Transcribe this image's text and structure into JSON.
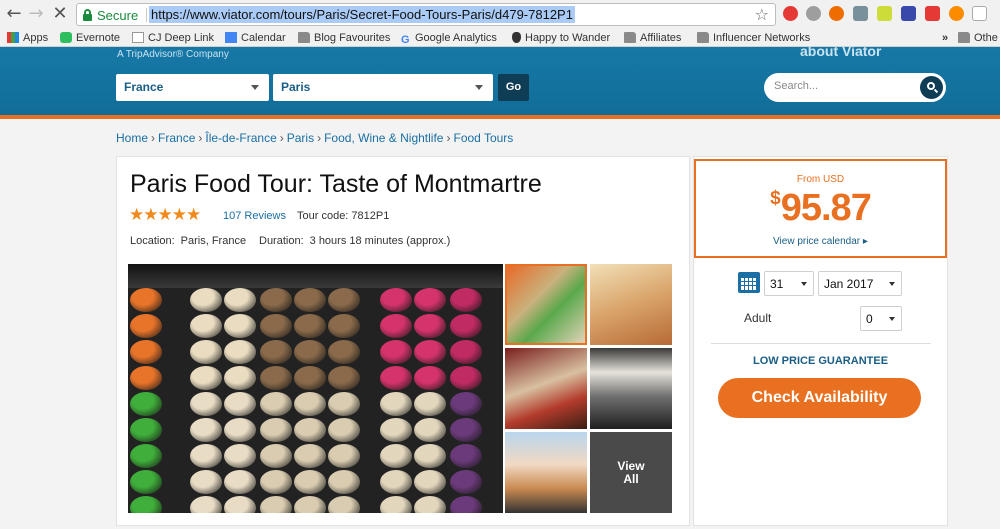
{
  "browser": {
    "secure_label": "Secure",
    "url": "https://www.viator.com/tours/Paris/Secret-Food-Tours-Paris/d479-7812P1",
    "bookmarks": [
      {
        "label": "Apps"
      },
      {
        "label": "Evernote"
      },
      {
        "label": "CJ Deep Link"
      },
      {
        "label": "Calendar"
      },
      {
        "label": "Blog Favourites"
      },
      {
        "label": "Google Analytics"
      },
      {
        "label": "Happy to Wander"
      },
      {
        "label": "Affiliates"
      },
      {
        "label": "Influencer Networks"
      }
    ],
    "overflow_label": "»",
    "other_label": "Othe"
  },
  "header": {
    "tagline": "A TripAdvisor® Company",
    "about_label": "about Viator",
    "country_select": "France",
    "city_select": "Paris",
    "go_label": "Go",
    "search_placeholder": "Search..."
  },
  "breadcrumb": [
    "Home",
    "France",
    "Île-de-France",
    "Paris",
    "Food, Wine & Nightlife",
    "Food Tours"
  ],
  "product": {
    "title": "Paris Food Tour: Taste of Montmartre",
    "rating": 5,
    "reviews_label": "107 Reviews",
    "tour_code": "Tour code: 7812P1",
    "location_label": "Location:",
    "location_value": "Paris, France",
    "duration_label": "Duration:",
    "duration_value": "3 hours 18 minutes (approx.)",
    "view_all_line1": "View",
    "view_all_line2": "All"
  },
  "booking": {
    "from_label": "From USD",
    "currency_symbol": "$",
    "price": "95.87",
    "calendar_link": "View price calendar ▸",
    "day": "31",
    "month": "Jan 2017",
    "adult_label": "Adult",
    "adult_count": "0",
    "guarantee": "LOW PRICE GUARANTEE",
    "check_label": "Check Availability"
  },
  "colors": {
    "brand_blue": "#1778a7",
    "accent_orange": "#e87020",
    "link_blue": "#1a6fa4"
  }
}
